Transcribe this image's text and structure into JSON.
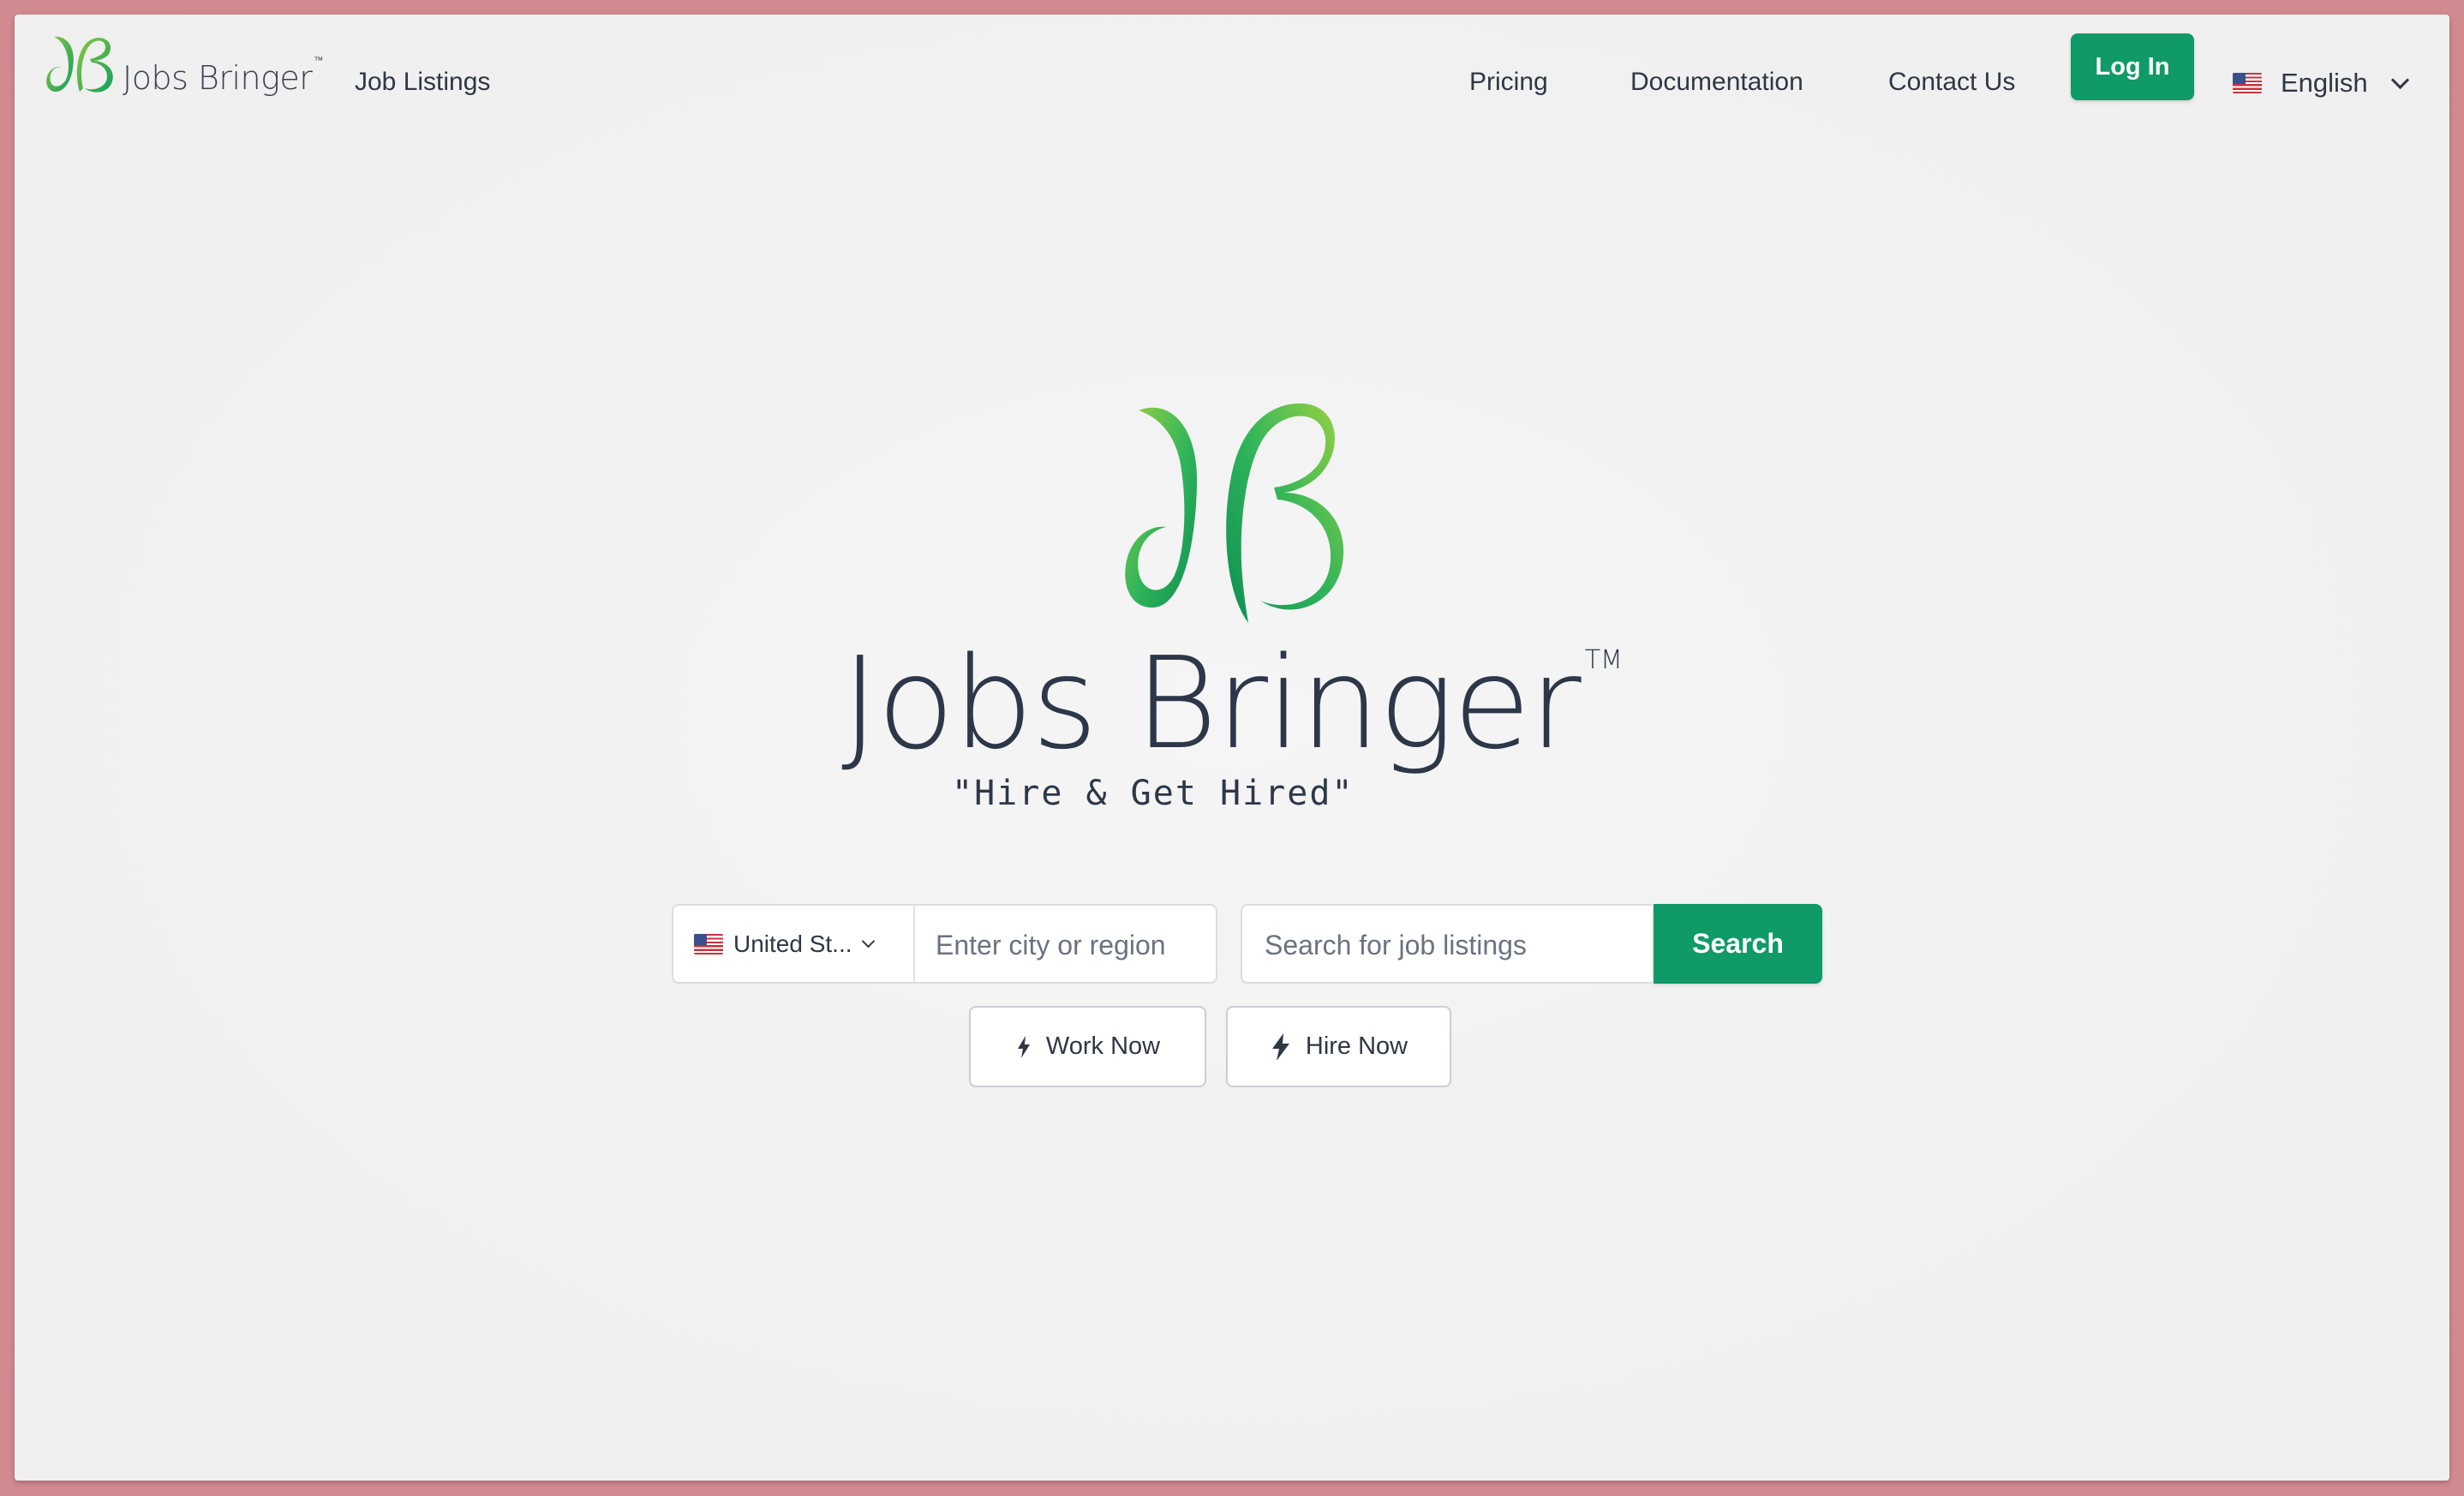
{
  "nav": {
    "brand": "Jobs Bringer",
    "brand_tm": "™",
    "job_listings": "Job Listings",
    "pricing": "Pricing",
    "documentation": "Documentation",
    "contact": "Contact Us",
    "login": "Log In",
    "language": "English",
    "language_flag_icon": "us-flag-icon"
  },
  "hero": {
    "title": "Jobs Bringer",
    "tm": "TM",
    "tagline": "\"Hire & Get Hired\""
  },
  "search": {
    "country": "United States",
    "country_display": "United St...",
    "city_placeholder": "Enter city or region",
    "job_placeholder": "Search for job listings",
    "search_label": "Search"
  },
  "actions": {
    "work_now": "Work Now",
    "hire_now": "Hire Now",
    "icon": "lightning-bolt-icon"
  },
  "colors": {
    "accent": "#0f9a67",
    "logo_green_light": "#8cc63f",
    "logo_green_dark": "#1a9a5a",
    "text": "#2c3749",
    "outer_border": "#d08a90"
  }
}
